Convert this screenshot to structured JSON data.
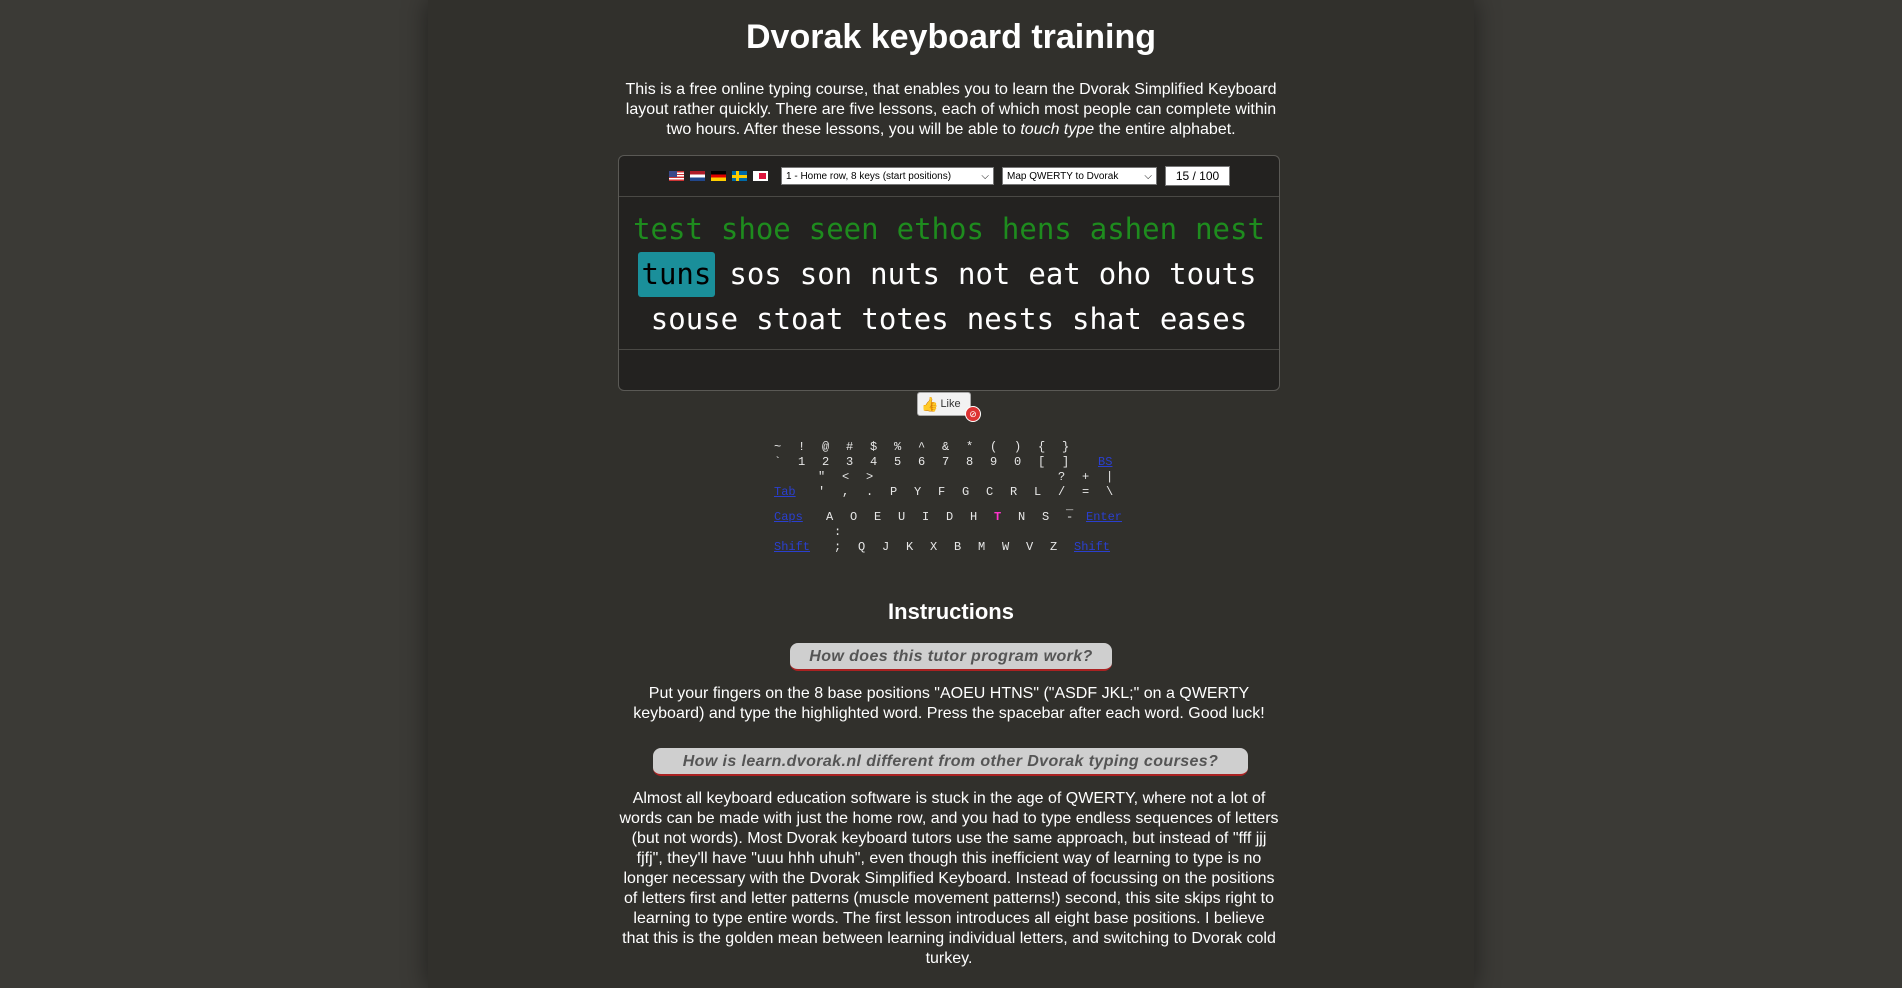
{
  "page": {
    "title": "Dvorak keyboard training",
    "intro_a": "This is a free online typing course, that enables you to learn the Dvorak Simplified Keyboard layout rather quickly. There are five lessons, each of which most people can complete within two hours. After these lessons, you will be able to ",
    "intro_em": "touch type",
    "intro_b": " the entire alphabet."
  },
  "trainer": {
    "flags": [
      "us-flag",
      "nl-flag",
      "de-flag",
      "se-flag",
      "pl-flag"
    ],
    "lesson_select": "1 - Home row, 8 keys (start positions)",
    "map_select": "Map QWERTY to Dvorak",
    "progress": "15 / 100",
    "lines": [
      [
        {
          "text": "test",
          "state": "done"
        },
        {
          "text": "shoe",
          "state": "done"
        },
        {
          "text": "seen",
          "state": "done"
        },
        {
          "text": "ethos",
          "state": "done"
        },
        {
          "text": "hens",
          "state": "done"
        },
        {
          "text": "ashen",
          "state": "done"
        },
        {
          "text": "nest",
          "state": "done"
        }
      ],
      [
        {
          "text": "tuns",
          "state": "current"
        },
        {
          "text": "sos",
          "state": "pending"
        },
        {
          "text": "son",
          "state": "pending"
        },
        {
          "text": "nuts",
          "state": "pending"
        },
        {
          "text": "not",
          "state": "pending"
        },
        {
          "text": "eat",
          "state": "pending"
        },
        {
          "text": "oho",
          "state": "pending"
        },
        {
          "text": "touts",
          "state": "pending"
        }
      ],
      [
        {
          "text": "souse",
          "state": "pending"
        },
        {
          "text": "stoat",
          "state": "pending"
        },
        {
          "text": "totes",
          "state": "pending"
        },
        {
          "text": "nests",
          "state": "pending"
        },
        {
          "text": "shat",
          "state": "pending"
        },
        {
          "text": "eases",
          "state": "pending"
        }
      ]
    ]
  },
  "like": {
    "label": "Like",
    "icon": "thumbs-up-icon",
    "badge_icon": "no-entry-icon"
  },
  "keyboard": {
    "highlight_key": "T",
    "highlight_color": "#ff33cc",
    "row1_shift": [
      "~",
      "!",
      "@",
      "#",
      "$",
      "%",
      "^",
      "&",
      "*",
      "(",
      ")",
      "{",
      "}"
    ],
    "row1": [
      "`",
      "1",
      "2",
      "3",
      "4",
      "5",
      "6",
      "7",
      "8",
      "9",
      "0",
      "[",
      "]",
      "BS"
    ],
    "row2_shift": [
      "\"",
      "<",
      ">",
      "?",
      "+",
      "|"
    ],
    "row2": [
      "Tab",
      "'",
      ",",
      ".",
      "P",
      "Y",
      "F",
      "G",
      "C",
      "R",
      "L",
      "/",
      "=",
      "\\"
    ],
    "row3": [
      "Caps",
      "A",
      "O",
      "E",
      "U",
      "I",
      "D",
      "H",
      "T",
      "N",
      "S",
      "-",
      "Enter"
    ],
    "row3_shift": [
      ":",
      "_"
    ],
    "row4": [
      "Shift",
      ";",
      "Q",
      "J",
      "K",
      "X",
      "B",
      "M",
      "W",
      "V",
      "Z",
      "Shift"
    ]
  },
  "instructions": {
    "heading": "Instructions",
    "q1": "How does this tutor program work?",
    "a1": "Put your fingers on the 8 base positions \"AOEU HTNS\" (\"ASDF JKL;\" on a QWERTY keyboard) and type the highlighted word. Press the spacebar after each word. Good luck!",
    "q2": "How is learn.dvorak.nl different from other Dvorak typing courses?",
    "a2": "Almost all keyboard education software is stuck in the age of QWERTY, where not a lot of words can be made with just the home row, and you had to type endless sequences of letters (but not words). Most Dvorak keyboard tutors use the same approach, but instead of \"fff jjj fjfj\", they'll have \"uuu hhh uhuh\", even though this inefficient way of learning to type is no longer necessary with the Dvorak Simplified Keyboard. Instead of focussing on the positions of letters first and letter patterns (muscle movement patterns!) second, this site skips right to learning to type entire words. The first lesson introduces all eight base positions. I believe that this is the golden mean between learning individual letters, and switching to Dvorak cold turkey."
  }
}
